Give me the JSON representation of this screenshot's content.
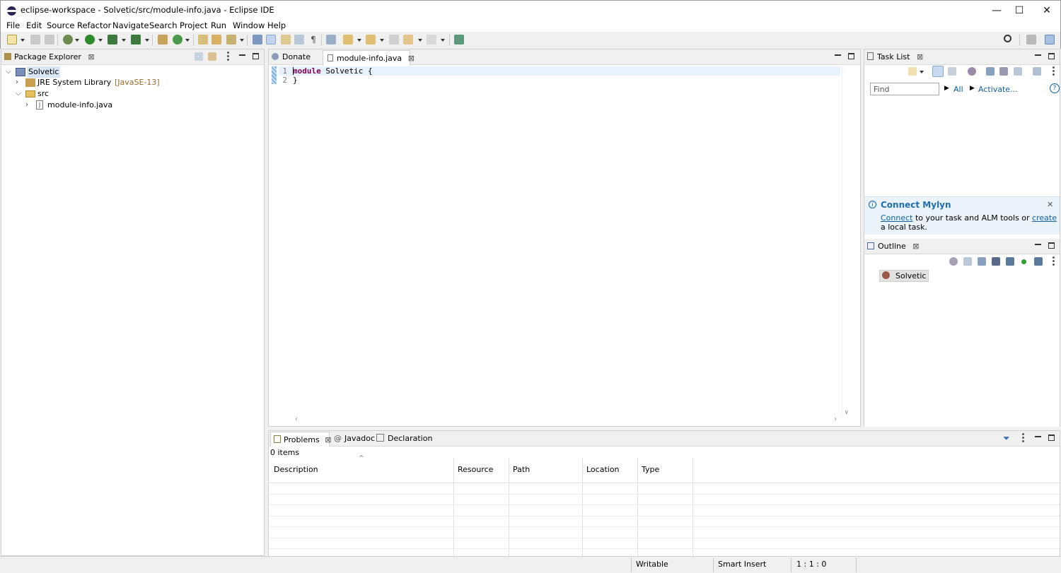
{
  "window": {
    "title": "eclipse-workspace - Solvetic/src/module-info.java - Eclipse IDE",
    "minimize": "—",
    "maximize": "☐",
    "close": "✕"
  },
  "menu": [
    "File",
    "Edit",
    "Source",
    "Refactor",
    "Navigate",
    "Search",
    "Project",
    "Run",
    "Window",
    "Help"
  ],
  "package_explorer": {
    "title": "Package Explorer",
    "tree": [
      {
        "label": "Solvetic",
        "level": 0,
        "expanded": true
      },
      {
        "label": "JRE System Library",
        "extra": "[JavaSE-13]",
        "level": 1,
        "expanded": false
      },
      {
        "label": "src",
        "level": 1,
        "expanded": true
      },
      {
        "label": "module-info.java",
        "level": 2,
        "expanded": false
      }
    ]
  },
  "editor": {
    "tabs": [
      {
        "label": "Donate",
        "active": false
      },
      {
        "label": "module-info.java",
        "active": true
      }
    ],
    "lines": [
      {
        "num": "1",
        "keyword": "module",
        "rest": " Solvetic {"
      },
      {
        "num": "2",
        "keyword": "",
        "rest": "}"
      }
    ]
  },
  "task_list": {
    "title": "Task List",
    "find_placeholder": "Find",
    "all_label": "All",
    "activate_label": "Activate...",
    "help": "?"
  },
  "mylyn": {
    "title": "Connect Mylyn",
    "connect": "Connect",
    "text1": "to your task and ALM tools or",
    "create": "create",
    "text2": "a local task."
  },
  "outline": {
    "title": "Outline",
    "item": "Solvetic"
  },
  "problems": {
    "tabs": [
      "Problems",
      "Javadoc",
      "Declaration"
    ],
    "count": "0 items",
    "columns": [
      "Description",
      "Resource",
      "Path",
      "Location",
      "Type"
    ]
  },
  "status": {
    "writable": "Writable",
    "insert_mode": "Smart Insert",
    "position": "1 : 1 : 0"
  },
  "colors": {
    "accent": "#0b5fa5",
    "keyword": "#7f0055",
    "eclipse_logo": "#2c2255"
  }
}
